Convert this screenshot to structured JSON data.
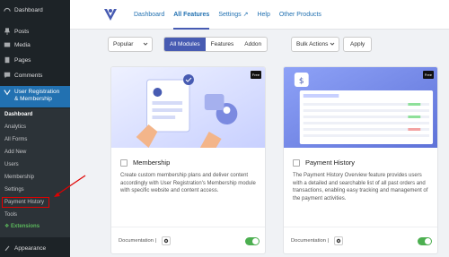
{
  "sidebar": {
    "items": [
      {
        "label": "Dashboard",
        "icon": "dashboard-icon"
      },
      {
        "label": "Posts",
        "icon": "pin-icon"
      },
      {
        "label": "Media",
        "icon": "media-icon"
      },
      {
        "label": "Pages",
        "icon": "pages-icon"
      },
      {
        "label": "Comments",
        "icon": "comment-icon"
      }
    ],
    "active_line1": "User Registration",
    "active_line2": "& Membership",
    "submenu": [
      "Dashboard",
      "Analytics",
      "All Forms",
      "Add New",
      "Users",
      "Membership",
      "Settings",
      "Payment History",
      "Tools",
      "Extensions"
    ],
    "appearance": "Appearance"
  },
  "topnav": {
    "links": [
      "Dashboard",
      "All Features",
      "Settings ↗",
      "Help",
      "Other Products"
    ]
  },
  "filters": {
    "popular": "Popular",
    "seg": [
      "All Modules",
      "Features",
      "Addon"
    ],
    "bulk": "Bulk Actions",
    "apply": "Apply"
  },
  "cards": [
    {
      "badge": "Free",
      "title": "Membership",
      "desc": "Create custom membership plans and deliver content accordingly with User Registration's Membership module with specific website and content access.",
      "doc": "Documentation"
    },
    {
      "badge": "Free",
      "title": "Payment History",
      "desc": "The Payment History Overview feature provides users with a detailed and searchable list of all past orders and transactions, enabling easy tracking and management of the payment activities.",
      "doc": "Documentation"
    }
  ],
  "colors": {
    "accent": "#475bb2",
    "wp_blue": "#2271b1",
    "sidebar_bg": "#1d2327",
    "toggle_on": "#4caf50",
    "highlight": "#e00000"
  }
}
